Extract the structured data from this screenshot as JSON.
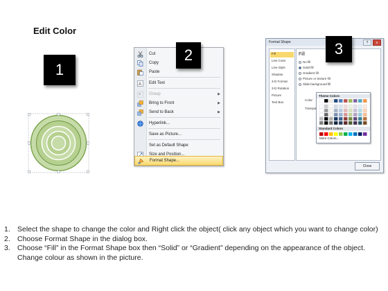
{
  "header": {
    "title": "Edit Color"
  },
  "badges": [
    "1",
    "2",
    "3"
  ],
  "context_menu": {
    "items": [
      {
        "label": "Cut",
        "icon": "scissors-icon",
        "disabled": false,
        "submenu": false
      },
      {
        "label": "Copy",
        "icon": "copy-icon",
        "disabled": false,
        "submenu": false
      },
      {
        "label": "Paste",
        "icon": "paste-icon",
        "disabled": false,
        "submenu": false
      },
      {
        "label": "Edit Text",
        "icon": "edit-text-icon",
        "disabled": false,
        "submenu": false
      },
      {
        "label": "Group",
        "icon": "group-icon",
        "disabled": true,
        "submenu": true
      },
      {
        "label": "Bring to Front",
        "icon": "bring-front-icon",
        "disabled": false,
        "submenu": true
      },
      {
        "label": "Send to Back",
        "icon": "send-back-icon",
        "disabled": false,
        "submenu": true
      },
      {
        "label": "Hyperlink...",
        "icon": "hyperlink-icon",
        "disabled": false,
        "submenu": false
      },
      {
        "label": "Save as Picture...",
        "icon": "",
        "disabled": false,
        "submenu": false
      },
      {
        "label": "Set as Default Shape",
        "icon": "",
        "disabled": false,
        "submenu": false
      },
      {
        "label": "Size and Position...",
        "icon": "size-icon",
        "disabled": false,
        "submenu": false
      },
      {
        "label": "Format Shape...",
        "icon": "format-shape-icon",
        "disabled": false,
        "submenu": false,
        "highlighted": true
      }
    ]
  },
  "dialog": {
    "title": "Format Shape",
    "help": "?",
    "close": "x",
    "categories": [
      "Fill",
      "Line Color",
      "Line Style",
      "Shadow",
      "3-D Format",
      "3-D Rotation",
      "Picture",
      "Text Box"
    ],
    "selected_category": "Fill",
    "fill_heading": "Fill",
    "fill_options": [
      {
        "label": "No fill",
        "selected": false
      },
      {
        "label": "Solid fill",
        "selected": true
      },
      {
        "label": "Gradient fill",
        "selected": false
      },
      {
        "label": "Picture or texture fill",
        "selected": false
      },
      {
        "label": "Slide background fill",
        "selected": false
      }
    ],
    "color_label": "Color:",
    "transparency_label": "Transpar",
    "close_button": "Close"
  },
  "color_picker": {
    "theme_colors_label": "Theme Colors",
    "standard_colors_label": "Standard Colors",
    "more_colors_label": "More Colors...",
    "theme_top": [
      "#ffffff",
      "#000000",
      "#eeece1",
      "#1f497d",
      "#4f81bd",
      "#c0504d",
      "#9bbb59",
      "#8064a2",
      "#4bacc6",
      "#f79646"
    ],
    "standard": [
      "#c00000",
      "#ff0000",
      "#ffc000",
      "#ffff00",
      "#92d050",
      "#00b050",
      "#00b0f0",
      "#0070c0",
      "#002060",
      "#7030a0"
    ]
  },
  "instructions": [
    {
      "num": "1.",
      "text": "Select the shape to change the color and Right click the object( click any object which you want to change color)"
    },
    {
      "num": "2.",
      "text": "Choose Format Shape in the dialog box."
    },
    {
      "num": "3.",
      "text": "Choose “Fill” in the Format Shape box then “Solid” or “Gradient” depending on the appearance of the object. Change colour as shown in the picture."
    }
  ],
  "colors": {
    "ring_outer": "#8db463",
    "ring_fill": "#bcd49b",
    "menu_highlight": "#f9d96d",
    "badge": "#000000"
  }
}
